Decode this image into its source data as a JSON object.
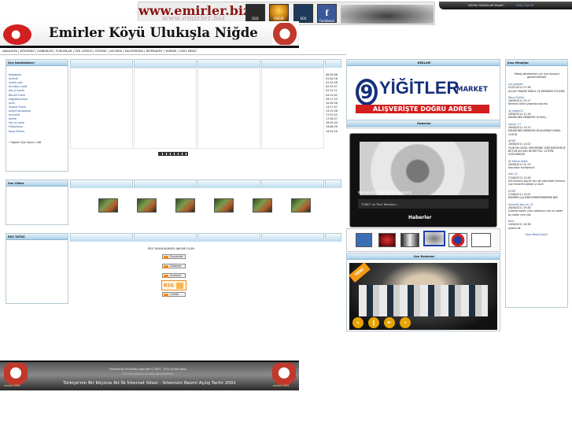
{
  "banner": {
    "brand": "www.emirler.biz",
    "tiles": [
      {
        "label": "EGS",
        "color": "#2b2b2b"
      },
      {
        "label": "ENGIN",
        "color": "#3a2e12"
      },
      {
        "label": "EEK",
        "color": "#1e3a5a"
      },
      {
        "label": "Facebook",
        "color": "#3b5998"
      }
    ],
    "hang_text": "HAYIRLI DAŞAKLAR Misafir!",
    "hang_text2": "Giriş | Üye Ol"
  },
  "site": {
    "title": "Emirler Köyü Ulukışla Niğde"
  },
  "nav": {
    "items": [
      "ANASAYFA",
      "KÖYÜMÜZ",
      "HABERLER",
      "FORUMLAR",
      "ÜYE LİSTESİ",
      "SİTEMİZ",
      "GECEREİ",
      "MULTIMEDYA",
      "İNTERAKTİF",
      "YARDIM",
      "ÖZEL MENÜ"
    ]
  },
  "members": {
    "title": "Üye İstatistikleri",
    "names": [
      "bulgaplen",
      "aslimle",
      "ismail_ugit",
      "tirmitan.n.bolt",
      "pto_ki.sayfa",
      "Bunzi21.brdl",
      "bagjabiluchaer",
      "pzirk",
      "Sozkut Yiukm",
      "ozkyirmar.begsor",
      "musulnfi",
      "derlek",
      "kisi_ki.sayfa",
      "Firatsilmaz",
      "Kaya Polmer"
    ],
    "times": [
      "00:28:08",
      "01:40:16",
      "01:42:56",
      "02:33:37",
      "03:12:11",
      "04:12:02",
      "09:17:43",
      "10:30:38",
      "13:27:47",
      "13:31:56",
      "17:32:43",
      "17:38:37",
      "18:34:44",
      "19:06:39",
      "19:35:20"
    ],
    "total": "• Toplam Üye Sayısı: 248"
  },
  "sections": {
    "videos": "Son Video",
    "rss": "RSS TATİKİ",
    "rss_title": "RSS YAYINLARIMIZA ABONE OLUN",
    "rss_items": [
      "Duyurular",
      "Haberler",
      "İncelene",
      "Forumlar",
      "Linkler"
    ],
    "rss_badge": "RSS"
  },
  "ad": {
    "title": "REKLAM",
    "logo_letter": "9",
    "logo_main": "YİĞİTLER",
    "logo_sub": "MARKET",
    "slogan": "ALIŞVERİŞTE DOĞRU ADRES"
  },
  "news": {
    "title": "Haberler",
    "headline": "Kamera Sistemi Tekrar Ayarlandı",
    "caption": "TTNET ve Türk Telekom...",
    "footer": "Haberler"
  },
  "photos": {
    "title": "Son Resimler",
    "badge": "YENİ"
  },
  "messages": {
    "title": "Kısa Mesajlar",
    "intro": "Mesaj göndermek için üye olmanız gerekmektedir.",
    "entries": [
      {
        "user": "yal_ozleptin",
        "date": "01/07/2011 07:38",
        "text": "ALLAH ORAMIZ KABUL VE MEBAREK EYLESIN."
      },
      {
        "user": "Resul Öztürk",
        "date": "28/08/2011 23:17",
        "text": "Kemerin bittiri yazmida olacma"
      },
      {
        "user": "ılo_dogen27",
        "date": "28/08/2011 21:18",
        "text": "KANDİLİNİZ MEBAREK OLSUN..."
      },
      {
        "user": "ramiar_27",
        "date": "28/08/2011 13:13",
        "text": "KANDİLİNİZ MEBAREK DUALARINIZ KABUL OLSUN"
      },
      {
        "user": "AYSET",
        "date": "28/08/2011 14:02",
        "text": "YILIN EN GÜZEL MEVSİMİNE GÖRÜŞMÜYORUZ BÜTÜN KIŞ KAR DEYRETTİK, LÜTFEN İLGELENELİM"
      },
      {
        "user": "Ali Kemal Saltın",
        "date": "28/08/2011 01:13",
        "text": "bosunkar kurdiyonun"
      },
      {
        "user": "zeki_01",
        "date": "27/08/2011 13:48",
        "text": "ahl-humarsi gayım ocu da yolumdeli humarsı yoz menerim gideye yi olum"
      },
      {
        "user": "AYSET",
        "date": "27/08/2011 12:01",
        "text": "RAMİRIN ÇALISMIYORRRRRRRRRRR BEE"
      },
      {
        "user": "mesmet_bey_ari_01",
        "date": "26/08/2011 19:48",
        "text": "kumera neden yine calsmiyor cok ne caden bu kadar yine yok"
      },
      {
        "user": "Kerri",
        "date": "24/08/2011 16:38",
        "text": "aysem de"
      }
    ],
    "more": "Kısa Mesaj Arşivi"
  },
  "footer": {
    "line1": "Powered by EmirlerBiz copyright © 2003 - 2011 by Nuk Jesso",
    "line2": "Tüm site kullanıcı ait aittir görüntülenme",
    "slogan": "Türkiye'nin Bir Köyüne Ait İlk İnternet Sitesi - Sitemizin Resmi Açılış Tarihi 2001",
    "badge": "emirler 2001"
  }
}
